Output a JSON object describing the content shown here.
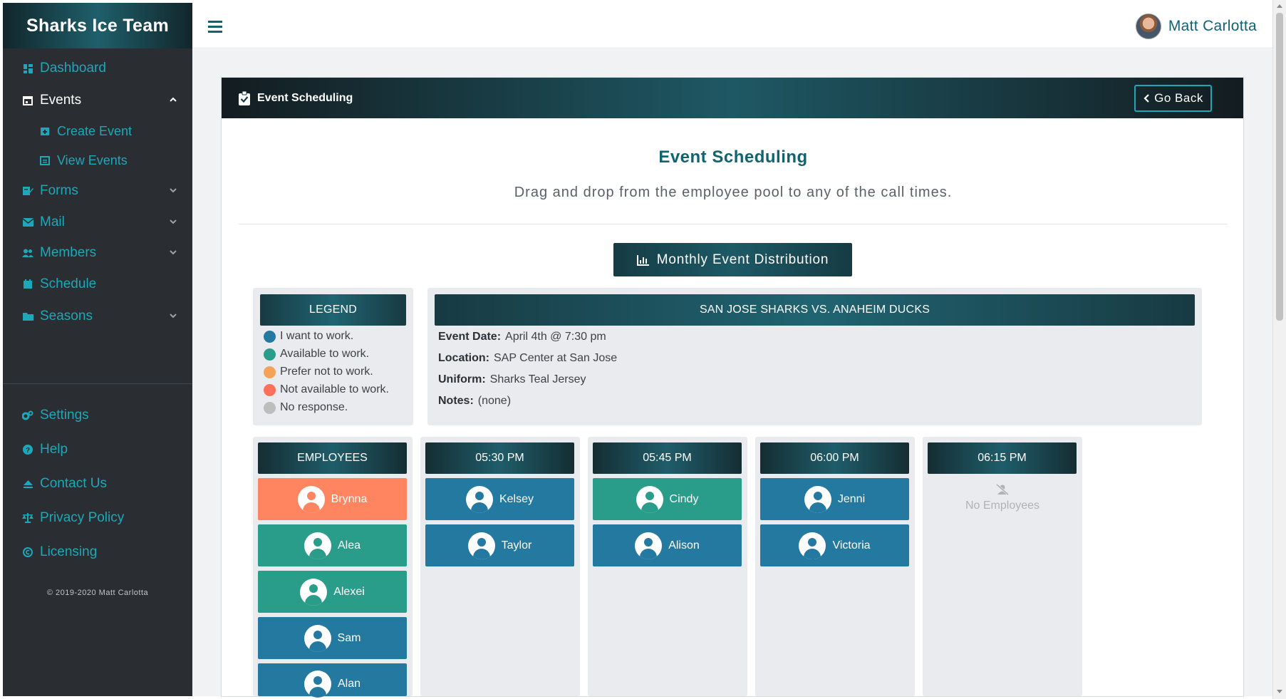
{
  "brand": {
    "title": "Sharks Ice Team"
  },
  "sidebar": {
    "items": [
      {
        "label": "Dashboard",
        "icon": "dashboard-icon"
      },
      {
        "label": "Events",
        "icon": "calendar-icon",
        "expanded": true
      },
      {
        "label": "Create Event",
        "icon": "calendar-plus-icon"
      },
      {
        "label": "View Events",
        "icon": "calendar-view-icon"
      },
      {
        "label": "Forms",
        "icon": "edit-icon"
      },
      {
        "label": "Mail",
        "icon": "mail-icon"
      },
      {
        "label": "Members",
        "icon": "members-icon"
      },
      {
        "label": "Schedule",
        "icon": "calendar-icon"
      },
      {
        "label": "Seasons",
        "icon": "folder-icon"
      },
      {
        "label": "Settings",
        "icon": "settings-icon"
      },
      {
        "label": "Help",
        "icon": "help-icon"
      },
      {
        "label": "Contact Us",
        "icon": "contact-icon"
      },
      {
        "label": "Privacy Policy",
        "icon": "scale-icon"
      },
      {
        "label": "Licensing",
        "icon": "copyright-icon"
      }
    ],
    "copyright": "© 2019-2020 Matt Carlotta"
  },
  "topbar": {
    "user_name": "Matt Carlotta"
  },
  "card": {
    "header_title": "Event Scheduling",
    "go_back_label": "Go Back",
    "title": "Event Scheduling",
    "subtitle": "Drag and drop from the employee pool to any of the call times.",
    "distribution_button": "Monthly Event Distribution"
  },
  "legend": {
    "title": "LEGEND",
    "items": [
      {
        "label": "I want to work.",
        "color": "#2479a0"
      },
      {
        "label": "Available to work.",
        "color": "#2a9d8a"
      },
      {
        "label": "Prefer not to work.",
        "color": "#f4a259"
      },
      {
        "label": "Not available to work.",
        "color": "#ff6f59"
      },
      {
        "label": "No response.",
        "color": "#bdbdbd"
      }
    ]
  },
  "event": {
    "title": "SAN JOSE SHARKS  VS.  ANAHEIM DUCKS",
    "date_label": "Event Date:",
    "date": "April 4th @ 7:30 pm",
    "location_label": "Location:",
    "location": "SAP Center at San Jose",
    "uniform_label": "Uniform:",
    "uniform": "Sharks Teal Jersey",
    "notes_label": "Notes:",
    "notes": "(none)"
  },
  "columns": [
    {
      "title": "EMPLOYEES",
      "employees": [
        {
          "name": "Brynna",
          "status": "orange"
        },
        {
          "name": "Alea",
          "status": "teal"
        },
        {
          "name": "Alexei",
          "status": "teal"
        },
        {
          "name": "Sam",
          "status": "blue"
        },
        {
          "name": "Alan",
          "status": "blue"
        }
      ]
    },
    {
      "title": "05:30 PM",
      "employees": [
        {
          "name": "Kelsey",
          "status": "blue"
        },
        {
          "name": "Taylor",
          "status": "blue"
        }
      ]
    },
    {
      "title": "05:45 PM",
      "employees": [
        {
          "name": "Cindy",
          "status": "teal"
        },
        {
          "name": "Alison",
          "status": "blue"
        }
      ]
    },
    {
      "title": "06:00 PM",
      "employees": [
        {
          "name": "Jenni",
          "status": "blue"
        },
        {
          "name": "Victoria",
          "status": "blue"
        }
      ]
    },
    {
      "title": "06:15 PM",
      "employees": [],
      "empty_label": "No Employees"
    }
  ]
}
